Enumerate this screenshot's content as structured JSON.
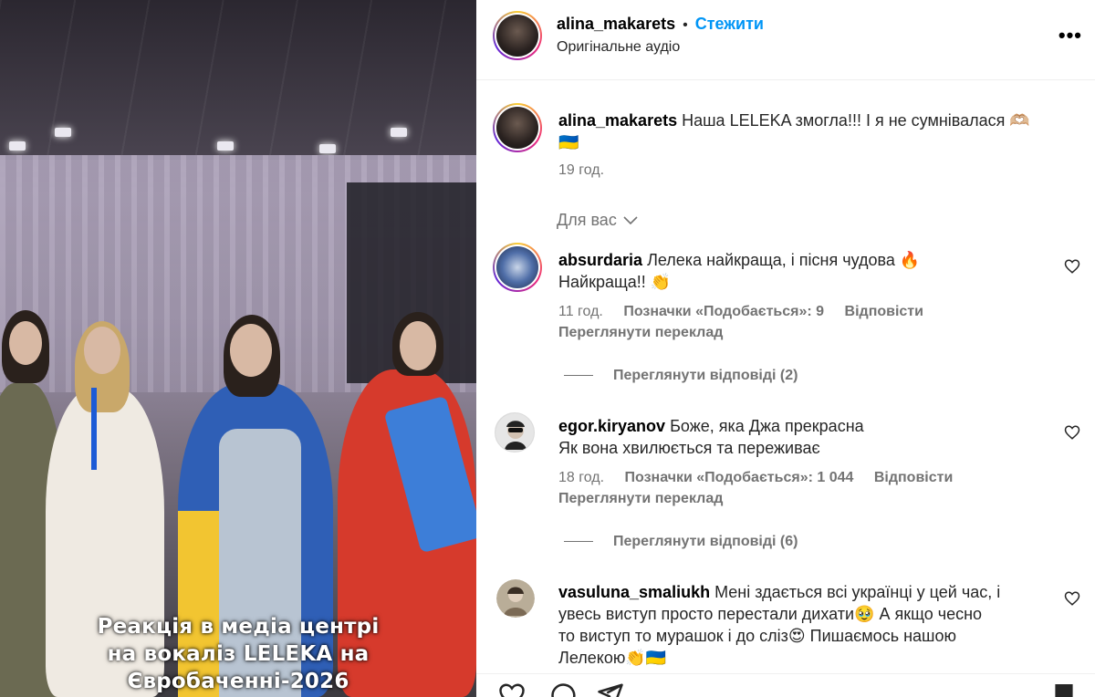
{
  "media": {
    "caption_lines": [
      "Реакція в медіа центрі",
      "на вокаліз LELEKA на",
      "Євробаченні-2026"
    ]
  },
  "header": {
    "username": "alina_makarets",
    "separator": "•",
    "follow_label": "Стежити",
    "audio_label": "Оригінальне аудіо",
    "more_label": "•••"
  },
  "post": {
    "username": "alina_makarets",
    "caption": "Наша LELEKA змогла!!! І я не сумнівалася 🫶🏼",
    "caption_line2": "🇺🇦",
    "time": "19 год."
  },
  "sort": {
    "label": "Для вас"
  },
  "comments": [
    {
      "username": "absurdaria",
      "text_line1": "Лелека найкраща, і пісня чудова 🔥",
      "text_line2": "Найкраща!! 👏",
      "time": "11 год.",
      "likes": "Позначки «Подобається»: 9",
      "reply": "Відповісти",
      "translate": "Переглянути переклад",
      "view_replies": "Переглянути відповіді (2)"
    },
    {
      "username": "egor.kiryanov",
      "text_line1": "Боже, яка Джа прекрасна",
      "text_line2": "Як вона хвилюється та переживає",
      "time": "18 год.",
      "likes": "Позначки «Подобається»: 1 044",
      "reply": "Відповісти",
      "translate": "Переглянути переклад",
      "view_replies": "Переглянути відповіді (6)"
    },
    {
      "username": "vasuluna_smaliukh",
      "text_line1": "Мені здається всі українці у цей час, і",
      "text_line2": "увесь виступ просто перестали дихати🥹  А якщо чесно",
      "text_line3": "то виступ то мурашок і до сліз😍  Пишаємось нашою",
      "text_line4": "Лелекою👏🇺🇦"
    }
  ],
  "colors": {
    "accent": "#0095f6",
    "text": "#262626",
    "muted": "#737373"
  }
}
